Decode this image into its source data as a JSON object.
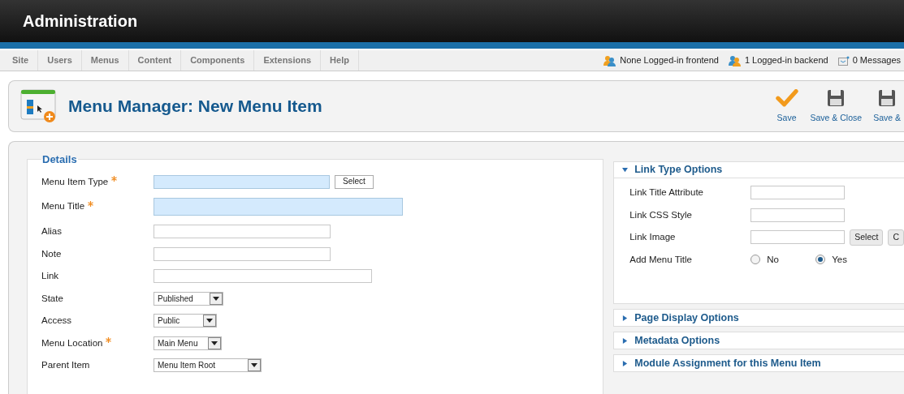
{
  "header": {
    "title": "Administration"
  },
  "menu": [
    {
      "label": "Site"
    },
    {
      "label": "Users"
    },
    {
      "label": "Menus"
    },
    {
      "label": "Content"
    },
    {
      "label": "Components"
    },
    {
      "label": "Extensions"
    },
    {
      "label": "Help"
    }
  ],
  "status": [
    {
      "kind": "frontend",
      "text": "None Logged-in frontend"
    },
    {
      "kind": "backend",
      "text": "1 Logged-in backend"
    },
    {
      "kind": "messages",
      "text": "0 Messages"
    }
  ],
  "toolbar": {
    "title": "Menu Manager: New Menu Item",
    "buttons": [
      {
        "kind": "check",
        "label": "Save"
      },
      {
        "kind": "floppy",
        "label": "Save & Close"
      },
      {
        "kind": "floppy",
        "label": "Save &"
      }
    ]
  },
  "details": {
    "legend": "Details",
    "fields": [
      {
        "label": "Menu Item Type",
        "kind": "text-button",
        "required": true,
        "highlighted": true,
        "button": "Select"
      },
      {
        "label": "Menu Title",
        "kind": "text",
        "required": true,
        "highlighted": true
      },
      {
        "label": "Alias",
        "kind": "text",
        "required": false,
        "highlighted": false
      },
      {
        "label": "Note",
        "kind": "text",
        "required": false,
        "highlighted": false
      },
      {
        "label": "Link",
        "kind": "text",
        "required": false,
        "highlighted": false
      },
      {
        "label": "State",
        "kind": "select",
        "required": false,
        "value": "Published"
      },
      {
        "label": "Access",
        "kind": "select",
        "required": false,
        "value": "Public"
      },
      {
        "label": "Menu Location",
        "kind": "select",
        "required": true,
        "value": "Main Menu"
      },
      {
        "label": "Parent Item",
        "kind": "select",
        "required": false,
        "value": "Menu Item Root"
      }
    ]
  },
  "options": [
    {
      "title": "Link Type Options",
      "expanded": true,
      "fields": [
        {
          "label": "Link Title Attribute",
          "kind": "text"
        },
        {
          "label": "Link CSS Style",
          "kind": "text"
        },
        {
          "label": "Link Image",
          "kind": "text-buttons",
          "buttons": [
            "Select",
            "C"
          ]
        },
        {
          "label": "Add Menu Title",
          "kind": "radio",
          "options": [
            {
              "label": "No",
              "selected": false
            },
            {
              "label": "Yes",
              "selected": true
            }
          ]
        }
      ]
    },
    {
      "title": "Page Display Options",
      "expanded": false
    },
    {
      "title": "Metadata Options",
      "expanded": false
    },
    {
      "title": "Module Assignment for this Menu Item",
      "expanded": false
    }
  ]
}
